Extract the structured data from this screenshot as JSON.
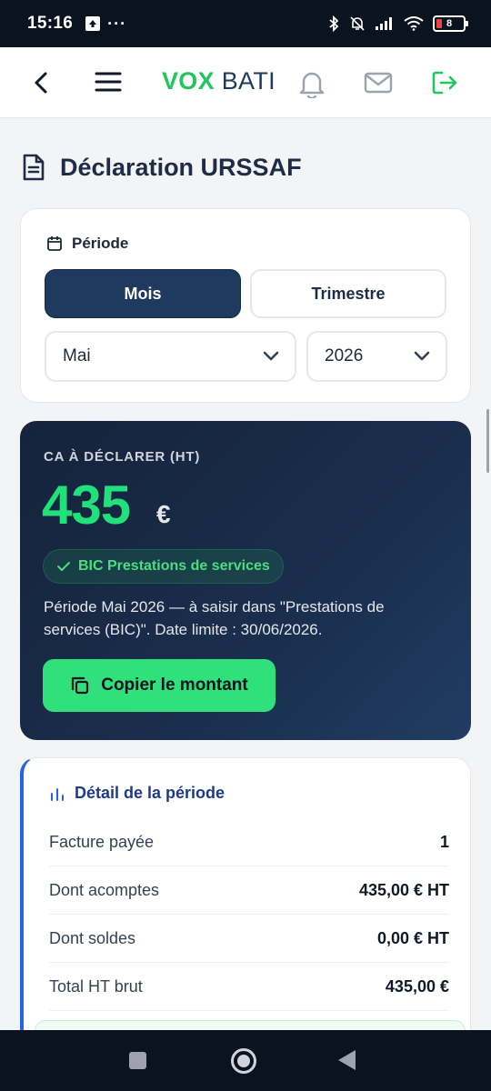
{
  "status_bar": {
    "time": "15:16",
    "more": "···",
    "battery": "8"
  },
  "app_bar": {
    "logo_part1": "VOX",
    "logo_part2": "BATI"
  },
  "page": {
    "title": "Déclaration URSSAF"
  },
  "period_card": {
    "label": "Période",
    "tabs": [
      {
        "label": "Mois",
        "active": true
      },
      {
        "label": "Trimestre",
        "active": false
      }
    ],
    "month_select": {
      "value": "Mai"
    },
    "year_select": {
      "value": "2026"
    }
  },
  "ca_card": {
    "caption": "CA À DÉCLARER (HT)",
    "amount": "435",
    "currency": "€",
    "badge": "BIC Prestations de services",
    "description": "Période Mai 2026 — à saisir dans \"Prestations de services (BIC)\". Date limite : 30/06/2026.",
    "copy_button": "Copier le montant"
  },
  "detail_card": {
    "title": "Détail de la période",
    "rows": [
      {
        "label": "Facture payée",
        "value": "1"
      },
      {
        "label": "Dont acomptes",
        "value": "435,00 € HT"
      },
      {
        "label": "Dont soldes",
        "value": "0,00 € HT"
      },
      {
        "label": "Total HT brut",
        "value": "435,00 €"
      }
    ]
  },
  "colors": {
    "brand_green": "#22c55e",
    "navy": "#1e3a5f",
    "amount_green": "#22e07a",
    "accent_blue": "#2563eb"
  }
}
